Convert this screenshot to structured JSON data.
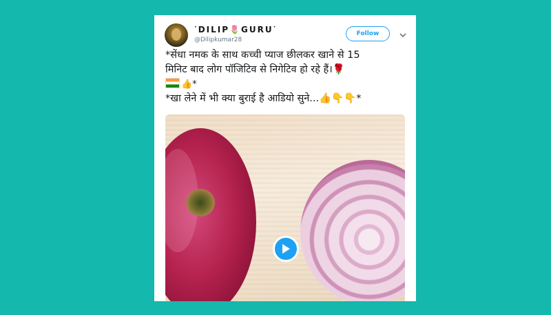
{
  "tweet": {
    "user": {
      "display_name": "ᐝDILIP🌷GURUᐝ",
      "handle": "@Dilipkumar28"
    },
    "follow_label": "Follow",
    "text_lines": [
      "*सेंधा नमक के साथ कच्ची प्याज छीलकर खाने से 15",
      "मिनिट बाद लोग पॉजिटिव से निगेटिव हो रहे हैं।🌹",
      "👍*",
      "*खा लेने में भी क्या बुराई है आडियो सुने...👍👇👇*"
    ],
    "media": {
      "type": "video",
      "play_icon": "play-icon"
    }
  },
  "colors": {
    "background": "#14b8ac",
    "accent": "#1da1f2"
  }
}
